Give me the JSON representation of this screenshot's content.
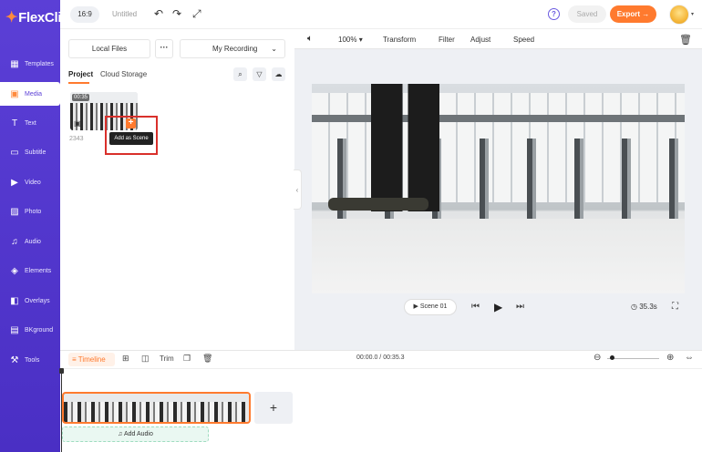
{
  "app": {
    "logo": "FlexClip"
  },
  "sidebar": {
    "items": [
      {
        "label": "Templates",
        "icon": "templates-icon"
      },
      {
        "label": "Media",
        "icon": "media-icon"
      },
      {
        "label": "Text",
        "icon": "text-icon"
      },
      {
        "label": "Subtitle",
        "icon": "subtitle-icon"
      },
      {
        "label": "Video",
        "icon": "video-icon"
      },
      {
        "label": "Photo",
        "icon": "photo-icon"
      },
      {
        "label": "Audio",
        "icon": "audio-icon"
      },
      {
        "label": "Elements",
        "icon": "elements-icon"
      },
      {
        "label": "Overlays",
        "icon": "overlays-icon"
      },
      {
        "label": "BKground",
        "icon": "background-icon"
      },
      {
        "label": "Tools",
        "icon": "tools-icon"
      }
    ],
    "active": "Media"
  },
  "topbar": {
    "ratio": "16:9",
    "project_name": "Untitled",
    "saved_label": "Saved",
    "export_label": "Export →"
  },
  "media": {
    "local_files": "Local Files",
    "more": "···",
    "source_select": "My Recording",
    "tabs": [
      "Project",
      "Cloud Storage"
    ],
    "item": {
      "duration": "00:35",
      "name": "2343"
    },
    "tooltip": "Add as Scene"
  },
  "preview_toolbar": {
    "zoom": "100%",
    "tools": [
      "Transform",
      "Filter",
      "Adjust",
      "Speed"
    ]
  },
  "player": {
    "scene_label": "Scene 01",
    "duration": "35.3s"
  },
  "timeline": {
    "label": "Timeline",
    "trim": "Trim",
    "time": "00:00.0 / 00:35.3",
    "add_audio": "Add Audio"
  },
  "colors": {
    "accent": "#ff7a2e",
    "sidebar": "#5b3fd6",
    "highlight": "#d9302b"
  }
}
